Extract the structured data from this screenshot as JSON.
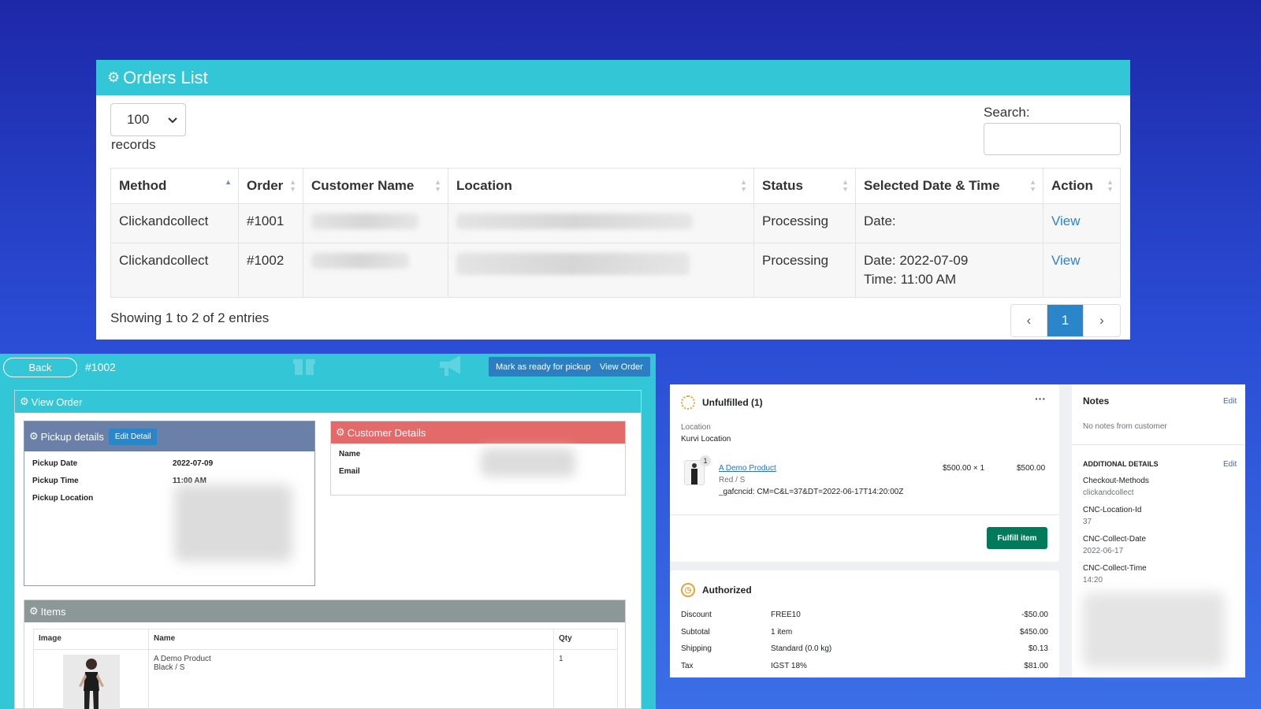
{
  "orders_list": {
    "title": "Orders List",
    "records_value": "100",
    "records_label": "records",
    "search_label": "Search:",
    "search_value": "",
    "columns": [
      "Method",
      "Order",
      "Customer Name",
      "Location",
      "Status",
      "Selected Date & Time",
      "Action"
    ],
    "rows": [
      {
        "method": "Clickandcollect",
        "order": "#1001",
        "status": "Processing",
        "date_line": "Date:",
        "time_line": "",
        "action": "View"
      },
      {
        "method": "Clickandcollect",
        "order": "#1002",
        "status": "Processing",
        "date_line": "Date: 2022-07-09",
        "time_line": "Time: 11:00 AM",
        "action": "View"
      }
    ],
    "entries_info": "Showing 1 to 2 of 2 entries",
    "pagination": {
      "prev": "‹",
      "current": "1",
      "next": "›"
    }
  },
  "view_order": {
    "back_label": "Back",
    "order_number": "#1002",
    "ready_button": "Mark as ready for pickup",
    "view_order_button": "View Order",
    "panel_title": "View Order",
    "pickup": {
      "title": "Pickup details",
      "edit_button": "Edit Detail",
      "date_label": "Pickup Date",
      "date_value": "2022-07-09",
      "time_label": "Pickup Time",
      "time_value": "11:00 AM",
      "location_label": "Pickup Location"
    },
    "customer": {
      "title": "Customer Details",
      "name_label": "Name",
      "email_label": "Email"
    },
    "items": {
      "title": "Items",
      "columns": [
        "Image",
        "Name",
        "Qty"
      ],
      "rows": [
        {
          "name": "A Demo Product",
          "variant": "Black / S",
          "qty": "1"
        }
      ]
    }
  },
  "admin": {
    "unfulfilled": {
      "title": "Unfulfilled (1)",
      "menu": "···",
      "location_label": "Location",
      "location_value": "Kurvi Location",
      "thumb_badge": "1",
      "product_name": "A Demo Product",
      "variant": "Red / S",
      "property": "_gafcncid: CM=C&L=37&DT=2022-06-17T14:20:00Z",
      "price_qty": "$500.00 × 1",
      "line_total": "$500.00",
      "fulfill_button": "Fulfill item"
    },
    "authorized": {
      "title": "Authorized",
      "rows": [
        {
          "label": "Discount",
          "detail": "FREE10",
          "amount": "-$50.00"
        },
        {
          "label": "Subtotal",
          "detail": "1 item",
          "amount": "$450.00"
        },
        {
          "label": "Shipping",
          "detail": "Standard (0.0 kg)",
          "amount": "$0.13"
        },
        {
          "label": "Tax",
          "detail": "IGST 18%",
          "amount": "$81.00"
        }
      ]
    },
    "notes": {
      "title": "Notes",
      "edit": "Edit",
      "empty": "No notes from customer",
      "additional_title": "ADDITIONAL DETAILS",
      "additional_edit": "Edit",
      "details": [
        {
          "key": "Checkout-Methods",
          "value": "clickandcollect"
        },
        {
          "key": "CNC-Location-Id",
          "value": "37"
        },
        {
          "key": "CNC-Collect-Date",
          "value": "2022-06-17"
        },
        {
          "key": "CNC-Collect-Time",
          "value": "14:20"
        }
      ]
    }
  },
  "icons": {
    "gear": "gear-icon",
    "sort": "sort-icon",
    "select_chevron": "chevron-down-icon",
    "gift": "gift-icon",
    "megaphone": "megaphone-icon",
    "unfulfilled_status": "unfulfilled-status-icon",
    "authorized_status": "clock-icon"
  },
  "colors": {
    "header_teal": "#33c6d6",
    "link_blue": "#2b86c9",
    "pickup_header": "#6a80a8",
    "customer_header": "#e46a6a",
    "items_header": "#8c9897",
    "fulfill_green": "#007a5a",
    "status_orange": "#e0a43a"
  }
}
